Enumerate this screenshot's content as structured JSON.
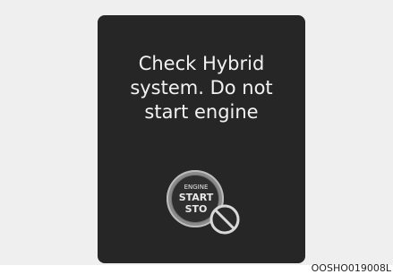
{
  "display": {
    "message_lines": [
      "Check  Hybrid",
      "system. Do not",
      "start engine"
    ]
  },
  "engine_button": {
    "line1": "ENGINE",
    "line2": "START",
    "line3": "STO"
  },
  "icons": {
    "prohibit": "no-symbol-icon"
  },
  "caption": "OOSHO019008L",
  "colors": {
    "background": "#efefef",
    "display": "#262626",
    "text": "#f2f2f2"
  }
}
